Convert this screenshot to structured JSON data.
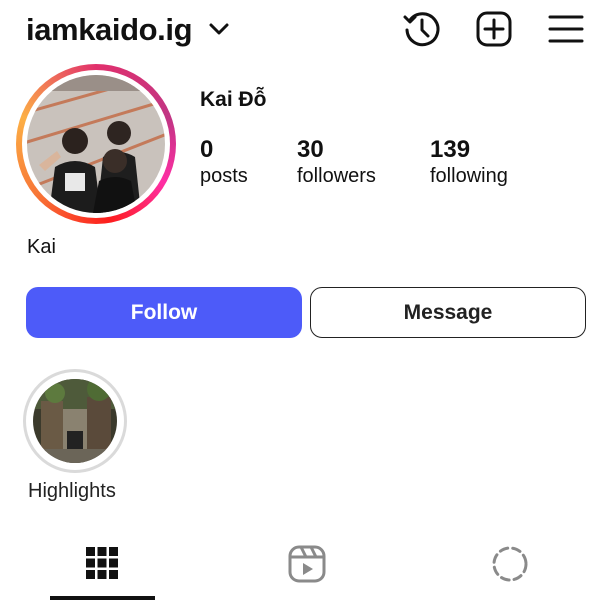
{
  "header": {
    "username": "iamkaido.ig",
    "icons": [
      "chevron-down-icon",
      "history-icon",
      "new-post-icon",
      "menu-icon"
    ]
  },
  "profile": {
    "display_name": "Kai Đỗ",
    "bio_name": "Kai",
    "stats": {
      "posts": {
        "count": "0",
        "label": "posts"
      },
      "followers": {
        "count": "30",
        "label": "followers"
      },
      "following": {
        "count": "139",
        "label": "following"
      }
    }
  },
  "actions": {
    "follow_label": "Follow",
    "message_label": "Message"
  },
  "highlights": [
    {
      "label": "Highlights"
    }
  ],
  "tabs": [
    {
      "icon": "grid-icon",
      "active": true
    },
    {
      "icon": "reels-icon",
      "active": false
    },
    {
      "icon": "tagged-icon",
      "active": false
    }
  ],
  "colors": {
    "follow_button": "#4d5bf9",
    "text": "#111111",
    "ring_gradient": [
      "#e1306c",
      "#c13584",
      "#fd1d1d",
      "#f77737",
      "#fcaf45"
    ]
  }
}
